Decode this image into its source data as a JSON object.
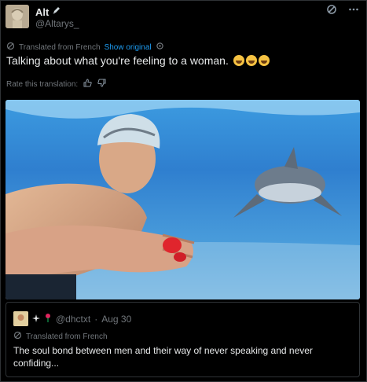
{
  "author": {
    "name": "Alt",
    "handle": "@Altarys_"
  },
  "icons": {
    "verified": "pencil-icon",
    "grok": "grok-icon",
    "more": "more-icon",
    "translate": "translate-icon",
    "settings": "gear-icon",
    "thumbs_up": "thumbs-up-icon",
    "thumbs_down": "thumbs-down-icon"
  },
  "translation": {
    "label": "Translated from French",
    "show_original": "Show original"
  },
  "tweet": {
    "text": "Talking about what you're feeling to a woman.",
    "emoji_count": 3
  },
  "rate": {
    "label": "Rate this translation:"
  },
  "quote": {
    "handle": "@dhctxt",
    "separator": "·",
    "date": "Aug 30",
    "translation_label": "Translated from French",
    "text": "The soul bond between men and their way of never speaking and never confiding..."
  },
  "colors": {
    "background": "#000000",
    "text": "#e7e9ea",
    "muted": "#71767b",
    "link": "#1d9bf0",
    "border": "#2f3336"
  }
}
